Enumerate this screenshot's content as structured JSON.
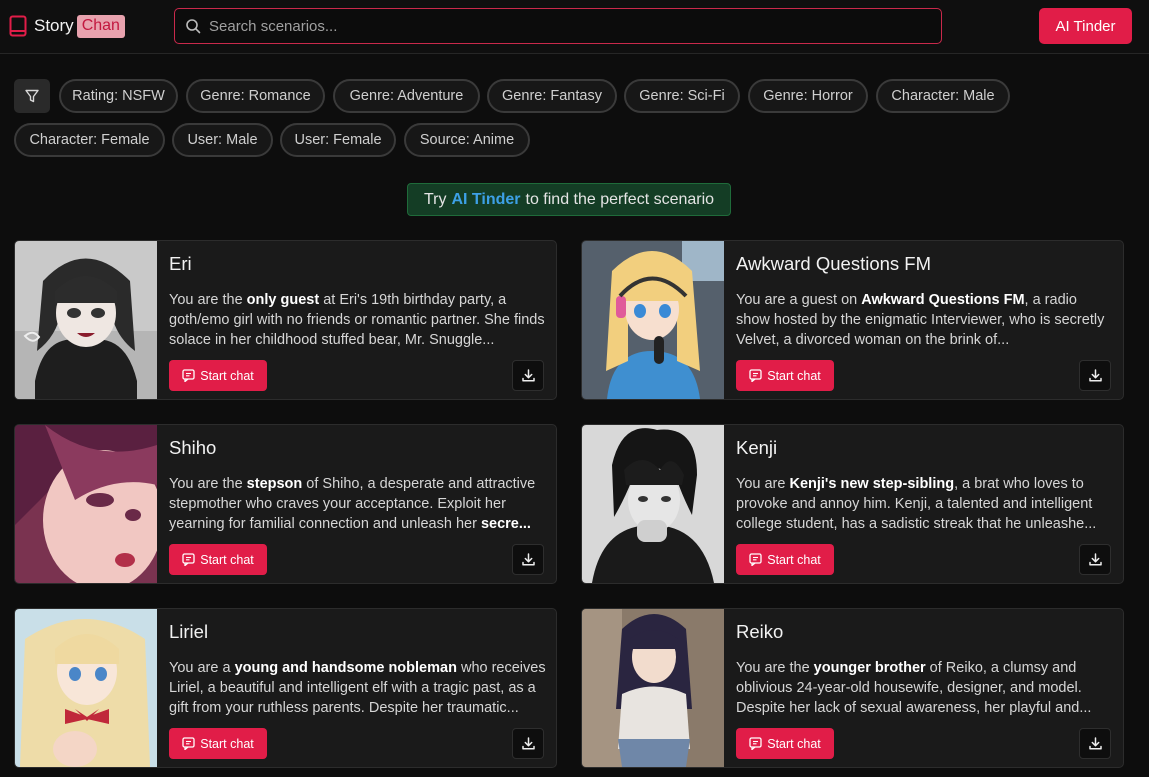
{
  "header": {
    "logo_text": "Story",
    "logo_badge": "Chan",
    "search_placeholder": "Search scenarios...",
    "ai_button": "AI Tinder"
  },
  "filters": [
    "Rating: NSFW",
    "Genre: Romance",
    "Genre: Adventure",
    "Genre: Fantasy",
    "Genre: Sci-Fi",
    "Genre: Horror",
    "Character: Male",
    "Character: Female",
    "User: Male",
    "User: Female",
    "Source: Anime"
  ],
  "promo": {
    "pre": "Try",
    "link": "AI Tinder",
    "post": "to find the perfect scenario"
  },
  "start_label": "Start chat",
  "cards": [
    {
      "title": "Eri",
      "desc": [
        {
          "t": "You are the "
        },
        {
          "b": "only guest"
        },
        {
          "t": " at Eri's 19th birthday party, a goth/emo girl with no friends or romantic partner. She finds solace in her childhood stuffed bear, Mr. Snuggle..."
        }
      ]
    },
    {
      "title": "Awkward Questions FM",
      "desc": [
        {
          "t": "You are a guest on "
        },
        {
          "b": "Awkward Questions FM"
        },
        {
          "t": ", a radio show hosted by the enigmatic Interviewer, who is secretly Velvet, a divorced woman on the brink of..."
        }
      ]
    },
    {
      "title": "Shiho",
      "desc": [
        {
          "t": "You are the "
        },
        {
          "b": "stepson"
        },
        {
          "t": " of Shiho, a desperate and attractive stepmother who craves your acceptance. Exploit her yearning for familial connection and unleash her "
        },
        {
          "b": "secre..."
        }
      ]
    },
    {
      "title": "Kenji",
      "desc": [
        {
          "t": "You are "
        },
        {
          "b": "Kenji's new step-sibling"
        },
        {
          "t": ", a brat who loves to provoke and annoy him. Kenji, a talented and intelligent college student, has a sadistic streak that he unleashe..."
        }
      ]
    },
    {
      "title": "Liriel",
      "desc": [
        {
          "t": "You are a "
        },
        {
          "b": "young and handsome nobleman"
        },
        {
          "t": " who receives Liriel, a beautiful and intelligent elf with a tragic past, as a gift from your ruthless parents. Despite her traumatic..."
        }
      ]
    },
    {
      "title": "Reiko",
      "desc": [
        {
          "t": "You are the "
        },
        {
          "b": "younger brother"
        },
        {
          "t": " of Reiko, a clumsy and oblivious 24-year-old housewife, designer, and model. Despite her lack of sexual awareness, her playful and..."
        }
      ]
    }
  ]
}
